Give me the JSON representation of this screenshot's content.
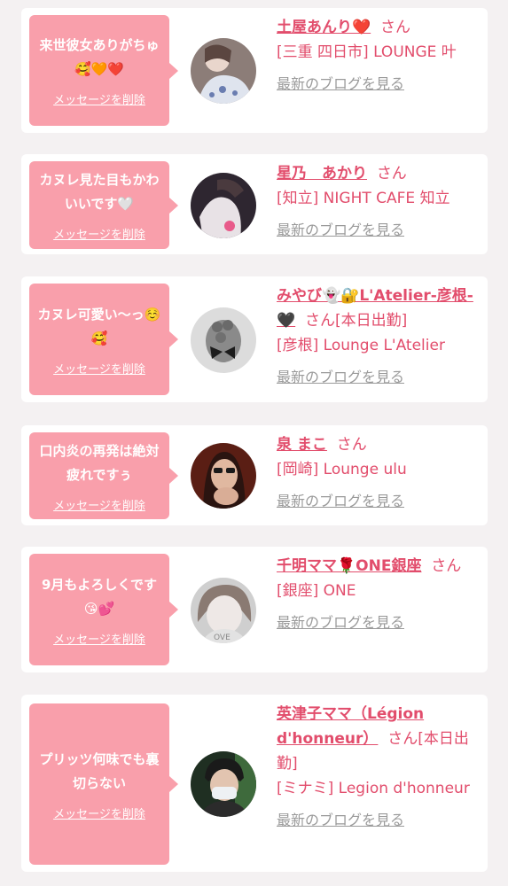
{
  "delete_label": "メッセージを削除",
  "blog_label": "最新のブログを見る",
  "san_label": "さん",
  "items": [
    {
      "message": "来世彼女ありがちゅ🥰🧡❤️",
      "name": "土屋あんり❤️",
      "suffix": "",
      "shop": "[三重 四日市] LOUNGE 叶"
    },
    {
      "message": "カヌレ見た目もかわいいです🤍",
      "name": "星乃　あかり",
      "suffix": "",
      "shop": "[知立] NIGHT CAFE 知立"
    },
    {
      "message": "カヌレ可愛い〜っ☺️🥰",
      "name": "みやび👻🔐L'Atelier-彦根-🖤",
      "suffix": "[本日出勤]",
      "shop": "[彦根] Lounge L'Atelier"
    },
    {
      "message": "口内炎の再発は絶対疲れですぅ",
      "name": "泉 まこ",
      "suffix": "",
      "shop": "[岡崎] Lounge ulu"
    },
    {
      "message": "9月もよろしくです😘💕",
      "name": "千明ママ🌹ONE銀座",
      "suffix": "",
      "shop": "[銀座] ONE"
    },
    {
      "message": "プリッツ何味でも裏切らない",
      "name": "英津子ママ（Légion d'honneur）",
      "suffix": "[本日出勤]",
      "shop": "[ミナミ] Legion d'honneur"
    }
  ]
}
